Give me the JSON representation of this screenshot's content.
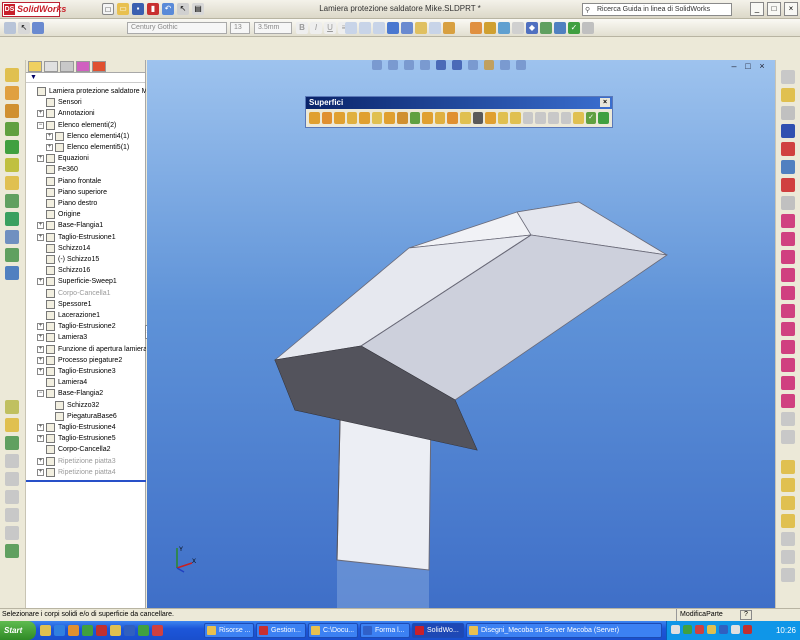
{
  "app": {
    "logo_text": "SolidWorks",
    "logo_mark": "DS",
    "window_title": "Lamiera protezione saldatore Mike.SLDPRT *",
    "help_search_placeholder": "Ricerca Guida in linea di SolidWorks"
  },
  "toolbar2": {
    "font_name": "Century Gothic",
    "font_size": "13",
    "line_width": "3.5mm"
  },
  "tree": {
    "filter_symbol": "▼",
    "items": [
      {
        "label": "Lamiera protezione saldatore Mike",
        "indent": 0,
        "expander": "",
        "dim": false
      },
      {
        "label": "Sensori",
        "indent": 1,
        "expander": "",
        "dim": false
      },
      {
        "label": "Annotazioni",
        "indent": 1,
        "expander": "+",
        "dim": false
      },
      {
        "label": "Elenco elementi(2)",
        "indent": 1,
        "expander": "−",
        "dim": false
      },
      {
        "label": "Elenco elementi4(1)",
        "indent": 2,
        "expander": "+",
        "dim": false
      },
      {
        "label": "Elenco elementi5(1)",
        "indent": 2,
        "expander": "+",
        "dim": false
      },
      {
        "label": "Equazioni",
        "indent": 1,
        "expander": "+",
        "dim": false
      },
      {
        "label": "Fe360",
        "indent": 1,
        "expander": "",
        "dim": false
      },
      {
        "label": "Piano frontale",
        "indent": 1,
        "expander": "",
        "dim": false
      },
      {
        "label": "Piano superiore",
        "indent": 1,
        "expander": "",
        "dim": false
      },
      {
        "label": "Piano destro",
        "indent": 1,
        "expander": "",
        "dim": false
      },
      {
        "label": "Origine",
        "indent": 1,
        "expander": "",
        "dim": false
      },
      {
        "label": "Base-Flangia1",
        "indent": 1,
        "expander": "+",
        "dim": false
      },
      {
        "label": "Taglio-Estrusione1",
        "indent": 1,
        "expander": "+",
        "dim": false
      },
      {
        "label": "Schizzo14",
        "indent": 1,
        "expander": "",
        "dim": false
      },
      {
        "label": "(-) Schizzo15",
        "indent": 1,
        "expander": "",
        "dim": false
      },
      {
        "label": "Schizzo16",
        "indent": 1,
        "expander": "",
        "dim": false
      },
      {
        "label": "Superficie-Sweep1",
        "indent": 1,
        "expander": "+",
        "dim": false
      },
      {
        "label": "Corpo-Cancella1",
        "indent": 1,
        "expander": "",
        "dim": true
      },
      {
        "label": "Spessore1",
        "indent": 1,
        "expander": "",
        "dim": false
      },
      {
        "label": "Lacerazione1",
        "indent": 1,
        "expander": "",
        "dim": false
      },
      {
        "label": "Taglio-Estrusione2",
        "indent": 1,
        "expander": "+",
        "dim": false
      },
      {
        "label": "Lamiera3",
        "indent": 1,
        "expander": "+",
        "dim": false
      },
      {
        "label": "Funzione di apertura lamiera2",
        "indent": 1,
        "expander": "+",
        "dim": false
      },
      {
        "label": "Processo piegature2",
        "indent": 1,
        "expander": "+",
        "dim": false
      },
      {
        "label": "Taglio-Estrusione3",
        "indent": 1,
        "expander": "+",
        "dim": false
      },
      {
        "label": "Lamiera4",
        "indent": 1,
        "expander": "",
        "dim": false
      },
      {
        "label": "Base-Flangia2",
        "indent": 1,
        "expander": "−",
        "dim": false
      },
      {
        "label": "Schizzo32",
        "indent": 2,
        "expander": "",
        "dim": false
      },
      {
        "label": "PiegaturaBase6",
        "indent": 2,
        "expander": "",
        "dim": false
      },
      {
        "label": "Taglio-Estrusione4",
        "indent": 1,
        "expander": "+",
        "dim": false
      },
      {
        "label": "Taglio-Estrusione5",
        "indent": 1,
        "expander": "+",
        "dim": false
      },
      {
        "label": "Corpo-Cancella2",
        "indent": 1,
        "expander": "",
        "dim": false
      },
      {
        "label": "Ripetizione piatta3",
        "indent": 1,
        "expander": "+",
        "dim": true
      },
      {
        "label": "Ripetizione piatta4",
        "indent": 1,
        "expander": "+",
        "dim": true
      }
    ]
  },
  "superfici": {
    "title": "Superfici",
    "close_symbol": "×"
  },
  "viewport": {
    "axis_y": "Y",
    "axis_x": "X"
  },
  "status": {
    "message": "Selezionare i corpi solidi e/o di superficie da cancellare.",
    "mode": "ModificaParte",
    "help_symbol": "?"
  },
  "taskbar": {
    "start_label": "Start",
    "buttons": [
      {
        "label": "Risorse ...",
        "color": "#e8c050",
        "active": false
      },
      {
        "label": "Gestion...",
        "color": "#c83030",
        "active": false
      },
      {
        "label": "C:\\Docu...",
        "color": "#e8c050",
        "active": false
      },
      {
        "label": "Forma l...",
        "color": "#3060c8",
        "active": false
      },
      {
        "label": "SolidWo...",
        "color": "#c8202a",
        "active": true
      },
      {
        "label": "Disegni_Mecoba su Server Mecoba (Server)",
        "color": "#e8c050",
        "active": false
      }
    ],
    "clock": "10:26"
  },
  "colors": {
    "viewport_top": "#9ec3ee",
    "viewport_bottom": "#3f6fc8",
    "part_light": "#eceef4",
    "part_mid": "#c8ccd8",
    "part_dark": "#4a4a52",
    "taskbar_blue": "#1c56d9"
  }
}
